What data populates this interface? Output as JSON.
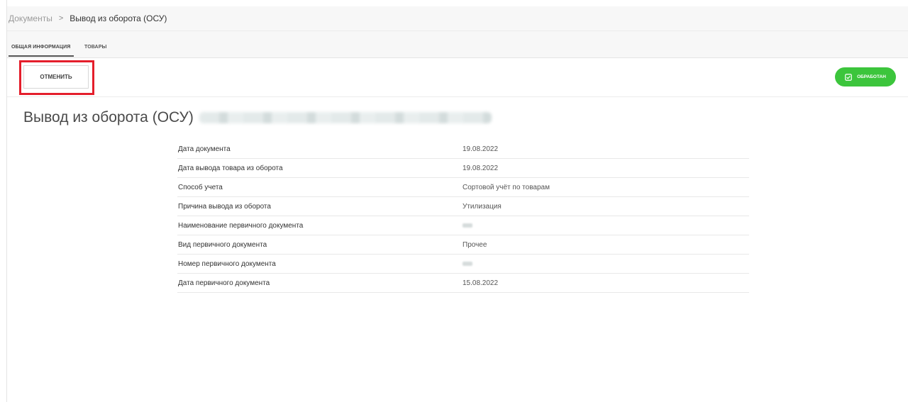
{
  "breadcrumb": {
    "parent": "Документы",
    "separator": ">",
    "current": "Вывод из оборота (ОСУ)"
  },
  "tabs": [
    {
      "label": "ОБЩАЯ ИНФОРМАЦИЯ",
      "active": true
    },
    {
      "label": "ТОВАРЫ",
      "active": false
    }
  ],
  "actions": {
    "cancel_label": "ОТМЕНИТЬ",
    "status_label": "ОБРАБОТАН",
    "status_icon": "checkbox-icon",
    "status_color": "#3cc53c",
    "highlight_color": "#e41e2b"
  },
  "document": {
    "title": "Вывод из оборота (ОСУ)",
    "fields": [
      {
        "label": "Дата документа",
        "value": "19.08.2022"
      },
      {
        "label": "Дата вывода товара из оборота",
        "value": "19.08.2022"
      },
      {
        "label": "Способ учета",
        "value": "Сортовой учёт по товарам"
      },
      {
        "label": "Причина вывода из оборота",
        "value": "Утилизация"
      },
      {
        "label": "Наименование первичного документа",
        "value": ""
      },
      {
        "label": "Вид первичного документа",
        "value": "Прочее"
      },
      {
        "label": "Номер первичного документа",
        "value": ""
      },
      {
        "label": "Дата первичного документа",
        "value": "15.08.2022"
      }
    ]
  }
}
